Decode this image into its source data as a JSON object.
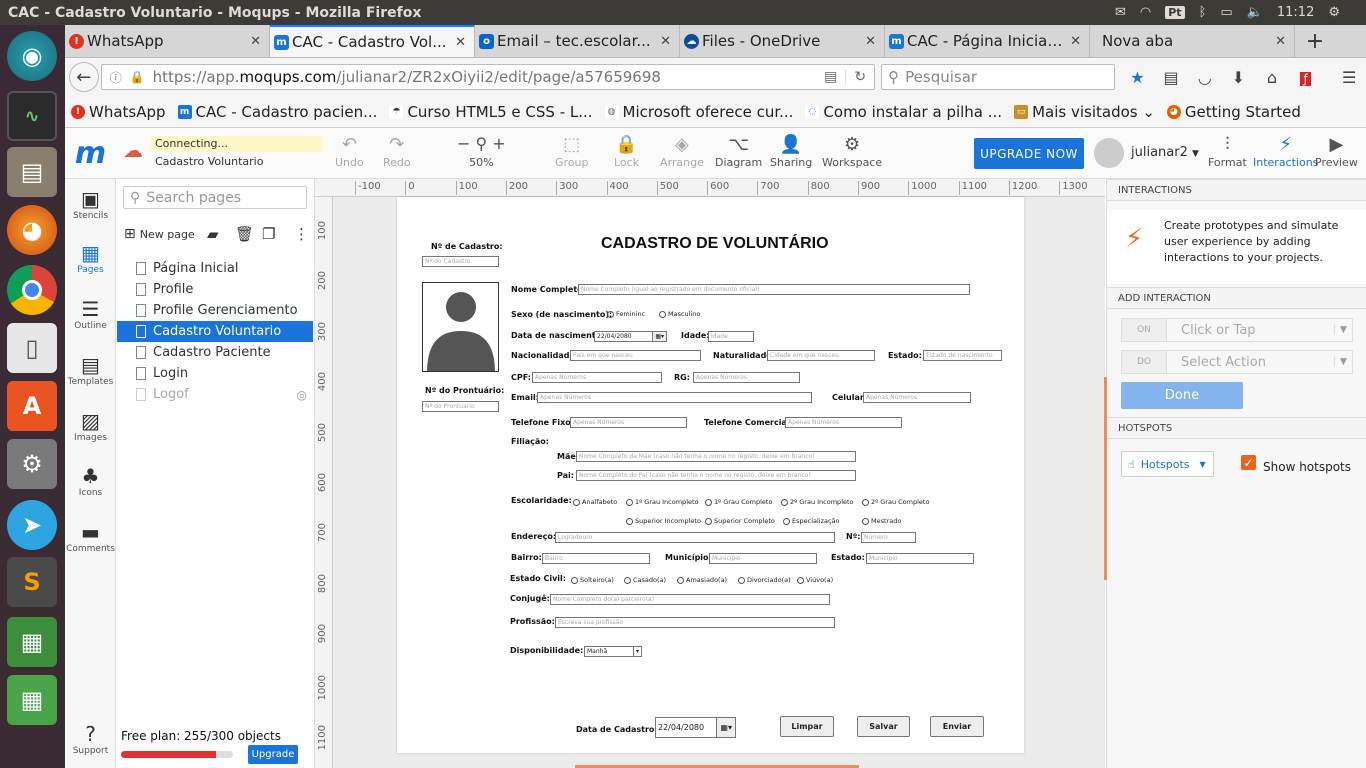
{
  "os": {
    "window_title": "CAC - Cadastro Voluntario - Moqups - Mozilla Firefox",
    "keyboard": "Pt",
    "clock": "11:12"
  },
  "browser": {
    "tabs": [
      {
        "label": "WhatsApp",
        "icon_color": "#e2311d",
        "active": false
      },
      {
        "label": "CAC - Cadastro Vol...",
        "icon_color": "#1b74d9",
        "active": true
      },
      {
        "label": "Email – tec.escolar...",
        "icon_color": "#0a64c8",
        "active": false
      },
      {
        "label": "Files - OneDrive",
        "icon_color": "#0a4f9e",
        "active": false
      },
      {
        "label": "CAC - Página Inicial ...",
        "icon_color": "#1b74d9",
        "active": false
      },
      {
        "label": "Nova aba",
        "icon_color": "",
        "active": false
      }
    ],
    "url_scheme": "https://app.",
    "url_host": "moqups.com",
    "url_path": "/julianar2/ZR2xOiyii2/edit/page/a57659698",
    "search_placeholder": "Pesquisar",
    "bookmarks": [
      {
        "label": "WhatsApp",
        "color": "#e2311d"
      },
      {
        "label": "CAC - Cadastro pacien...",
        "color": "#1b74d9"
      },
      {
        "label": "Curso HTML5 e CSS - L...",
        "color": "#333333"
      },
      {
        "label": "Microsoft oferece cur...",
        "color": "#666666"
      },
      {
        "label": "Como instalar a pilha ...",
        "color": "#2a7de1"
      },
      {
        "label": "Mais visitados ⌄",
        "color": "#c8902a"
      },
      {
        "label": "Getting Started",
        "color": "#e66000"
      }
    ]
  },
  "toolbar": {
    "status": "Connecting...",
    "page_name": "Cadastro Voluntario",
    "undo": "Undo",
    "redo": "Redo",
    "zoom": "50%",
    "group": "Group",
    "lock": "Lock",
    "arrange": "Arrange",
    "diagram": "Diagram",
    "sharing": "Sharing",
    "workspace": "Workspace",
    "upgrade": "UPGRADE NOW",
    "user": "julianar2",
    "format": "Format",
    "interactions": "Interactions",
    "preview": "Preview"
  },
  "rail": {
    "stencils": "Stencils",
    "pages": "Pages",
    "outline": "Outline",
    "templates": "Templates",
    "images": "Images",
    "icons": "Icons",
    "comments": "Comments",
    "support": "Support"
  },
  "pages_panel": {
    "search_placeholder": "Search pages",
    "new_page": "New page",
    "pages": [
      {
        "label": "Página Inicial",
        "active": false,
        "hidden": false
      },
      {
        "label": "Profile",
        "active": false,
        "hidden": false
      },
      {
        "label": "Profile Gerenciamento",
        "active": false,
        "hidden": false
      },
      {
        "label": "Cadastro Voluntario",
        "active": true,
        "hidden": false
      },
      {
        "label": "Cadastro Paciente",
        "active": false,
        "hidden": false
      },
      {
        "label": "Login",
        "active": false,
        "hidden": false
      },
      {
        "label": "Logof",
        "active": false,
        "hidden": true
      }
    ],
    "plan_text": "Free plan: 255/300 objects",
    "plan_usage_fraction": 0.85,
    "upgrade": "Upgrade"
  },
  "rulers": {
    "h": [
      "-100",
      "0",
      "100",
      "200",
      "300",
      "400",
      "500",
      "600",
      "700",
      "800",
      "900",
      "1000",
      "1100",
      "1200",
      "1300"
    ],
    "v": [
      "100",
      "200",
      "300",
      "400",
      "500",
      "600",
      "700",
      "800",
      "900",
      "1000",
      "1100"
    ]
  },
  "form": {
    "title": "CADASTRO DE VOLUNTÁRIO",
    "num_cadastro_label": "Nº de Cadastro:",
    "num_cadastro_ph": "Nº do Cadastro",
    "num_prontuario_label": "Nº do Prontuário:",
    "num_prontuario_ph": "Nº do Prontuario",
    "nome_label": "Nome Completo:",
    "nome_ph": "Nome Completo (igual ao registrado em documento oficial)",
    "sexo_label": "Sexo (de nascimento):",
    "sexo_f": "Femininc",
    "sexo_m": "Masculino",
    "nasc_label": "Data de nascimento):",
    "nasc_value": "22/04/2080",
    "idade_label": "Idade:",
    "idade_ph": "Idade",
    "nacionalidade_label": "Nacionalidade:",
    "nacionalidade_ph": "País em que nasceu",
    "naturalidade_label": "Naturalidade:",
    "naturalidade_ph": "Cidade em que nasceu",
    "estado_label": "Estado:",
    "estado_ph": "Estado de nascimento",
    "cpf_label": "CPF:",
    "cpf_ph": "Apenas Números",
    "rg_label": "RG:",
    "rg_ph": "Apenas Números",
    "email_label": "Email:",
    "email_ph": "Apenas Números",
    "celular_label": "Celular:",
    "celular_ph": "Apenas Números",
    "tel_fixo_label": "Telefone Fixo:",
    "tel_fixo_ph": "Apenas Números",
    "tel_com_label": "Telefone Comercial:",
    "tel_com_ph": "Apenas Números",
    "filiacao_label": "Filiação:",
    "mae_label": "Mãe:",
    "mae_ph": "Nome Completo da Mãe (caso não tenha o nome no registo, deixe em branco)",
    "pai_label": "Pai:",
    "pai_ph": "Nome Completo do Pai (caso não tenha o nome no registo, deixe em branco)",
    "escolaridade_label": "Escolaridade:",
    "escolaridade": [
      "Analfabeto",
      "1º Grau Incompleto",
      "1º Grau Completo",
      "2º Grau Incompleto",
      "2º Grau Completo",
      "Superior Incompleto",
      "Superior Completo",
      "Especialização",
      "Mestrado"
    ],
    "endereco_label": "Endereço:",
    "endereco_ph": "Logradouro",
    "numero_label": "Nº:",
    "numero_ph": "Número",
    "bairro_label": "Bairro:",
    "bairro_ph": "Bairro",
    "municipio_label": "Município:",
    "municipio_ph": "Município",
    "estado2_label": "Estado:",
    "estado2_ph": "Município",
    "civil_label": "Estado Civil:",
    "civil": [
      "Solteiro(a)",
      "Casado(a)",
      "Amasiado(a)",
      "Divorciado(a)",
      "Viúvo(a)"
    ],
    "conjuge_label": "Conjugê:",
    "conjuge_ph": "Nome Completo do(a) parceiro(a)",
    "profissao_label": "Profissão:",
    "profissao_ph": "Escreva sua profissão",
    "disp_label": "Disponibilidade:",
    "disp_value": "Manhã",
    "data_cad_label": "Data de Cadastro:",
    "data_cad_value": "22/04/2080",
    "limpar": "Limpar",
    "salvar": "Salvar",
    "enviar": "Enviar"
  },
  "right_panel": {
    "interactions_header": "INTERACTIONS",
    "interactions_desc": "Create prototypes and simulate user experience by adding interactions to your projects.",
    "add_header": "ADD INTERACTION",
    "on_tag": "ON",
    "on_value": "Click or Tap",
    "do_tag": "DO",
    "do_value": "Select Action",
    "done": "Done",
    "hotspots_header": "HOTSPOTS",
    "hotspots_btn": "Hotspots",
    "show_hotspots": "Show hotspots",
    "show_hotspots_checked": true
  }
}
